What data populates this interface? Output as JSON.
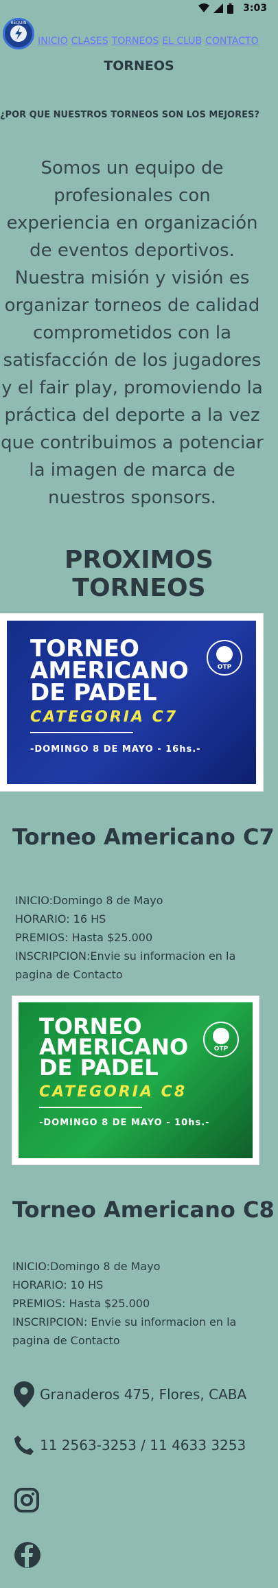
{
  "status": {
    "time": "3:03",
    "icons": [
      "wifi-icon",
      "signal-icon",
      "battery-icon"
    ]
  },
  "logo": {
    "text": "REQUIN"
  },
  "nav": {
    "items": [
      "INICIO",
      "CLASES",
      "TORNEOS",
      "EL CLUB",
      "CONTACTO"
    ]
  },
  "page": {
    "title": "TORNEOS"
  },
  "intro": {
    "question": "¿POR QUE NUESTROS TORNEOS SON LOS MEJORES?",
    "text": "Somos un equipo de profesionales con experiencia en organización de eventos deportivos. Nuestra misión y visión es organizar torneos de calidad comprometidos con la satisfacción de los jugadores y el fair play, promoviendo la práctica del deporte a la vez que contribuimos a potenciar la imagen de marca de nuestros sponsors."
  },
  "section": {
    "title": "PROXIMOS TORNEOS"
  },
  "tournaments": [
    {
      "banner_title_1": "TORNEO",
      "banner_title_2": "AMERICANO",
      "banner_title_3": "DE PADEL",
      "banner_category": "CATEGORIA C7",
      "banner_date": "-DOMINGO 8 DE MAYO - 16hs.-",
      "badge": "OTP",
      "heading": "Torneo Americano C7",
      "inicio": "INICIO:Domingo 8 de Mayo",
      "horario": "HORARIO: 16 HS",
      "premios": "PREMIOS: Hasta $25.000",
      "inscripcion": "INSCRIPCION:Envie su informacion en la pagina de Contacto"
    },
    {
      "banner_title_1": "TORNEO",
      "banner_title_2": "AMERICANO",
      "banner_title_3": "DE PADEL",
      "banner_category": "CATEGORIA C8",
      "banner_date": "-DOMINGO 8 DE MAYO - 10hs.-",
      "badge": "OTP",
      "heading": "Torneo Americano C8",
      "inicio": "INICIO:Domingo 8 de Mayo",
      "horario": "HORARIO: 10 HS",
      "premios": "PREMIOS: Hasta $25.000",
      "inscripcion": "INSCRIPCION: Envie su informacion en la pagina de Contacto"
    }
  ],
  "contact": {
    "address": "Granaderos 475, Flores, CABA",
    "phone": "11 2563-3253 / 11 4633 3253"
  },
  "colors": {
    "background": "#8fbbb0",
    "nav_link": "#6a72ff",
    "text": "#2b3a40"
  }
}
